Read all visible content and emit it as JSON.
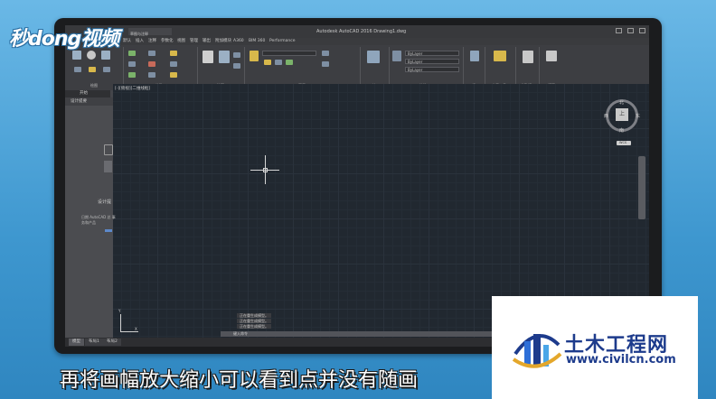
{
  "watermark": "秒dong视频",
  "app": {
    "title": "Autodesk AutoCAD 2016   Drawing1.dwg",
    "quick_access": "草图与注释",
    "menu": [
      "默认",
      "插入",
      "注释",
      "参数化",
      "视图",
      "管理",
      "输出",
      "附加模块",
      "A360",
      "BIM 360",
      "Performance"
    ],
    "ribbon_groups": [
      "绘图",
      "修改",
      "注释",
      "图层",
      "块",
      "特性",
      "组",
      "实用工具",
      "剪贴板",
      "视图"
    ],
    "ribbon_combos": [
      "ByLayer",
      "ByLayer",
      "ByLayer"
    ],
    "tabs": [
      "开始",
      "Drawing1*"
    ],
    "viewport_label": "[-][俯视][二维线框]",
    "panel_header": "设计提要",
    "panel_title": "设计提",
    "panel_desc": "日期 AutoCAD 总 事务和产品",
    "viewcube": {
      "top": "北",
      "west": "西",
      "east": "东",
      "south": "南",
      "face": "上",
      "wcs": "WCS"
    },
    "ucs": {
      "y": "Y",
      "x": "X"
    },
    "command_history": [
      "正在重生成模型。",
      "正在重生成模型。",
      "正在重生成模型。"
    ],
    "command_placeholder": "键入命令",
    "status_tabs": [
      "模型",
      "布局1",
      "布局2"
    ]
  },
  "subtitle": "再将画幅放大缩小可以看到点并没有随画",
  "logo": {
    "title": "土木工程网",
    "url": "www.civilcn.com"
  }
}
